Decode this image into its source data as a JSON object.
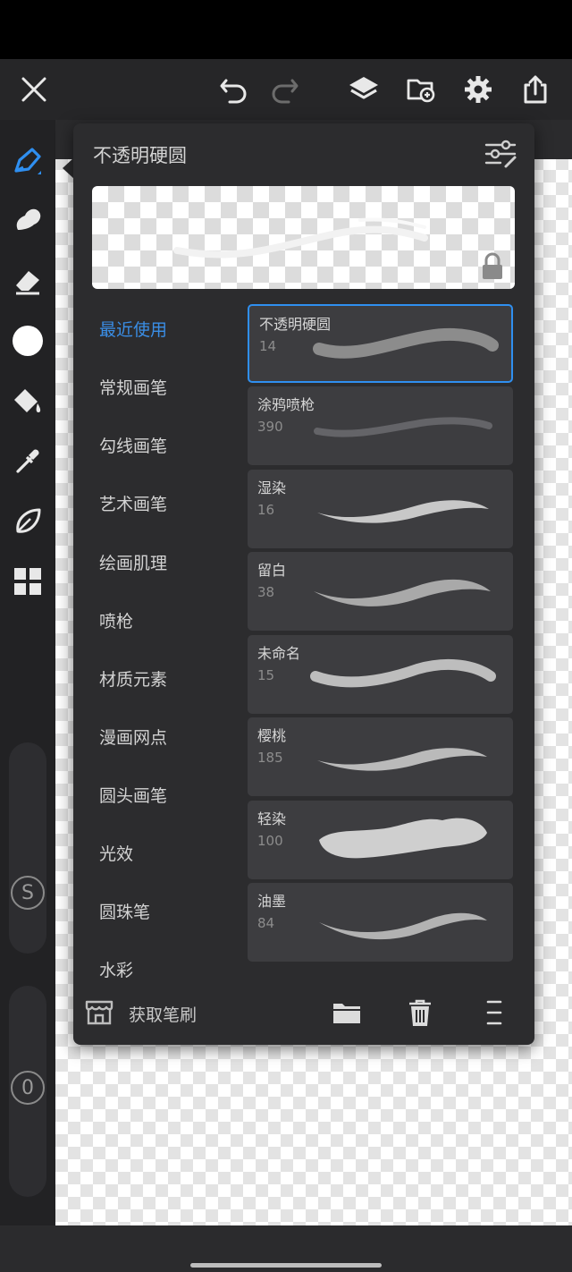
{
  "panel": {
    "title": "不透明硬圆"
  },
  "categories": [
    {
      "label": "最近使用",
      "active": true
    },
    {
      "label": "常规画笔",
      "active": false
    },
    {
      "label": "勾线画笔",
      "active": false
    },
    {
      "label": "艺术画笔",
      "active": false
    },
    {
      "label": "绘画肌理",
      "active": false
    },
    {
      "label": "喷枪",
      "active": false
    },
    {
      "label": "材质元素",
      "active": false
    },
    {
      "label": "漫画网点",
      "active": false
    },
    {
      "label": "圆头画笔",
      "active": false
    },
    {
      "label": "光效",
      "active": false
    },
    {
      "label": "圆珠笔",
      "active": false
    },
    {
      "label": "水彩",
      "active": false
    }
  ],
  "brushes": [
    {
      "name": "不透明硬圆",
      "size": "14",
      "selected": true
    },
    {
      "name": "涂鸦喷枪",
      "size": "390",
      "selected": false
    },
    {
      "name": "湿染",
      "size": "16",
      "selected": false
    },
    {
      "name": "留白",
      "size": "38",
      "selected": false
    },
    {
      "name": "未命名",
      "size": "15",
      "selected": false
    },
    {
      "name": "樱桃",
      "size": "185",
      "selected": false
    },
    {
      "name": "轻染",
      "size": "100",
      "selected": false
    },
    {
      "name": "油墨",
      "size": "84",
      "selected": false
    }
  ],
  "footer": {
    "get_brushes_label": "获取笔刷"
  },
  "sliders": {
    "size_label": "S",
    "opacity_label": "0"
  },
  "icons": {
    "top_bar": [
      "close-icon",
      "undo-icon",
      "redo-icon",
      "layers-icon",
      "gallery-icon",
      "settings-icon",
      "share-icon"
    ],
    "left_tools": [
      "brush-icon",
      "smudge-icon",
      "eraser-icon",
      "color-icon",
      "fill-icon",
      "eyedropper-icon",
      "leaf-icon",
      "grid-icon"
    ]
  },
  "colors": {
    "accent": "#2f8ff0",
    "panel_bg": "#2c2c2e",
    "card_bg": "#3d3d40",
    "current_color": "#ffffff"
  }
}
